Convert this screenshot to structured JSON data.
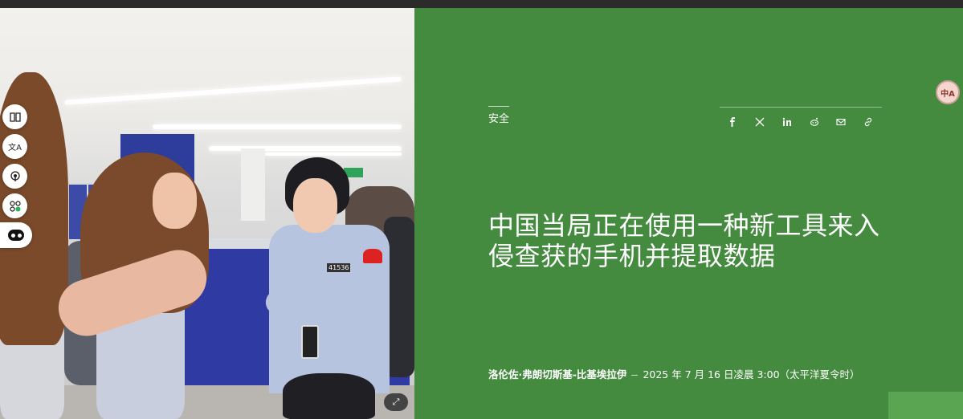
{
  "article": {
    "category": "安全",
    "headline": "中国当局正在使用一种新工具来入侵查获的手机并提取数据",
    "author": "洛伦佐·弗朗切斯基-比基埃拉伊",
    "date": "2025 年 7 月 16 日凌晨 3:00（太平洋夏令时）"
  },
  "share_icons": [
    "facebook-icon",
    "x-icon",
    "linkedin-icon",
    "reddit-icon",
    "mail-icon",
    "link-icon"
  ],
  "side_toolbar": [
    "book-icon",
    "translate-icon",
    "podcast-icon",
    "apps-icon",
    "assistant-bot-icon"
  ],
  "photo": {
    "badge_text": "41536"
  },
  "translate_bubble": "中A",
  "colors": {
    "panel_bg": "#458b3f",
    "accent_block": "#5aa552",
    "text": "#ffffff"
  }
}
